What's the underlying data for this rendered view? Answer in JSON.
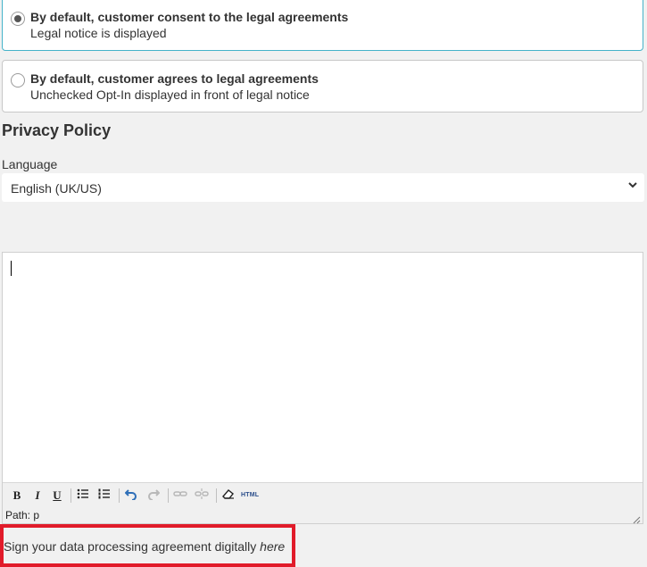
{
  "consent_options": [
    {
      "title": "By default, customer consent to the legal agreements",
      "description": "Legal notice is displayed",
      "selected": true
    },
    {
      "title": "By default, customer agrees to legal agreements",
      "description": "Unchecked Opt-In displayed in front of legal notice",
      "selected": false
    }
  ],
  "privacy_policy": {
    "heading": "Privacy Policy",
    "language_label": "Language",
    "language_value": "English (UK/US)"
  },
  "editor": {
    "content": "",
    "toolbar": {
      "bold": "B",
      "italic": "I",
      "underline": "U",
      "html": "HTML"
    },
    "path_text": "Path: p"
  },
  "footer": {
    "text": "Sign your data processing agreement digitally ",
    "link_text": "here",
    "highlight_color": "#e11b2a"
  }
}
